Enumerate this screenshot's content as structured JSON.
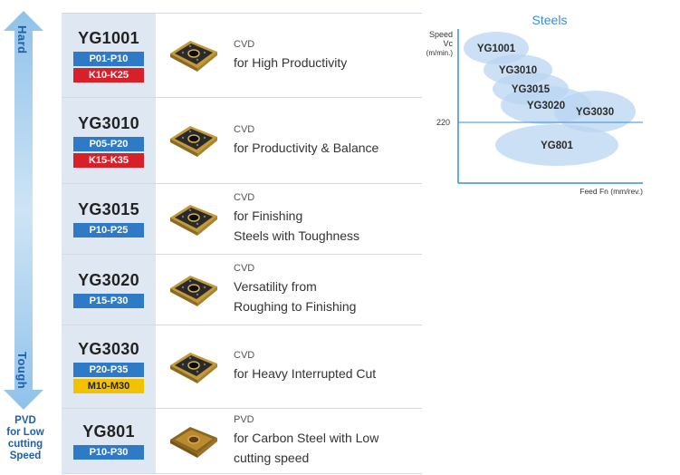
{
  "side": {
    "hard": "Hard",
    "tough": "Tough",
    "pvd_note": [
      "PVD",
      "for Low",
      "cutting",
      "Speed"
    ]
  },
  "rows": [
    {
      "grade": "YG1001",
      "badges": [
        {
          "text": "P01-P10",
          "color": "blue"
        },
        {
          "text": "K10-K25",
          "color": "red"
        }
      ],
      "coating": "CVD",
      "desc": [
        "for High Productivity"
      ],
      "insert": "cvd-insert-icon"
    },
    {
      "grade": "YG3010",
      "badges": [
        {
          "text": "P05-P20",
          "color": "blue"
        },
        {
          "text": "K15-K35",
          "color": "red"
        }
      ],
      "coating": "CVD",
      "desc": [
        "for Productivity & Balance"
      ],
      "insert": "cvd-insert-icon"
    },
    {
      "grade": "YG3015",
      "badges": [
        {
          "text": "P10-P25",
          "color": "blue"
        }
      ],
      "coating": "CVD",
      "desc": [
        "for Finishing",
        "Steels with Toughness"
      ],
      "insert": "cvd-insert-icon"
    },
    {
      "grade": "YG3020",
      "badges": [
        {
          "text": "P15-P30",
          "color": "blue"
        }
      ],
      "coating": "CVD",
      "desc": [
        "Versatility from",
        "Roughing to Finishing"
      ],
      "insert": "cvd-insert-icon"
    },
    {
      "grade": "YG3030",
      "badges": [
        {
          "text": "P20-P35",
          "color": "blue"
        },
        {
          "text": "M10-M30",
          "color": "yellow"
        }
      ],
      "coating": "CVD",
      "desc": [
        "for Heavy Interrupted Cut"
      ],
      "insert": "cvd-insert-icon"
    },
    {
      "grade": "YG801",
      "badges": [
        {
          "text": "P10-P30",
          "color": "blue"
        }
      ],
      "coating": "PVD",
      "desc": [
        "for Carbon Steel with Low",
        "cutting speed"
      ],
      "insert": "pvd-insert-icon"
    }
  ],
  "colors": {
    "blue_badge": "#2e7ac6",
    "red_badge": "#d8202a",
    "yellow_badge": "#f2c100",
    "grade_bg": "#dfe7f2",
    "chart_accent": "#3a8fd6",
    "ellipse_fill": "#b9d6f2"
  },
  "chart_data": {
    "type": "scatter",
    "title": "Steels",
    "ylabel": [
      "Speed",
      "Vc",
      "(m/min.)"
    ],
    "xlabel": "Feed Fn (mm/rev.)",
    "y_reference_tick": "220",
    "regions": [
      {
        "name": "YG1001"
      },
      {
        "name": "YG3010"
      },
      {
        "name": "YG3015"
      },
      {
        "name": "YG3020"
      },
      {
        "name": "YG3030"
      },
      {
        "name": "YG801"
      }
    ]
  }
}
